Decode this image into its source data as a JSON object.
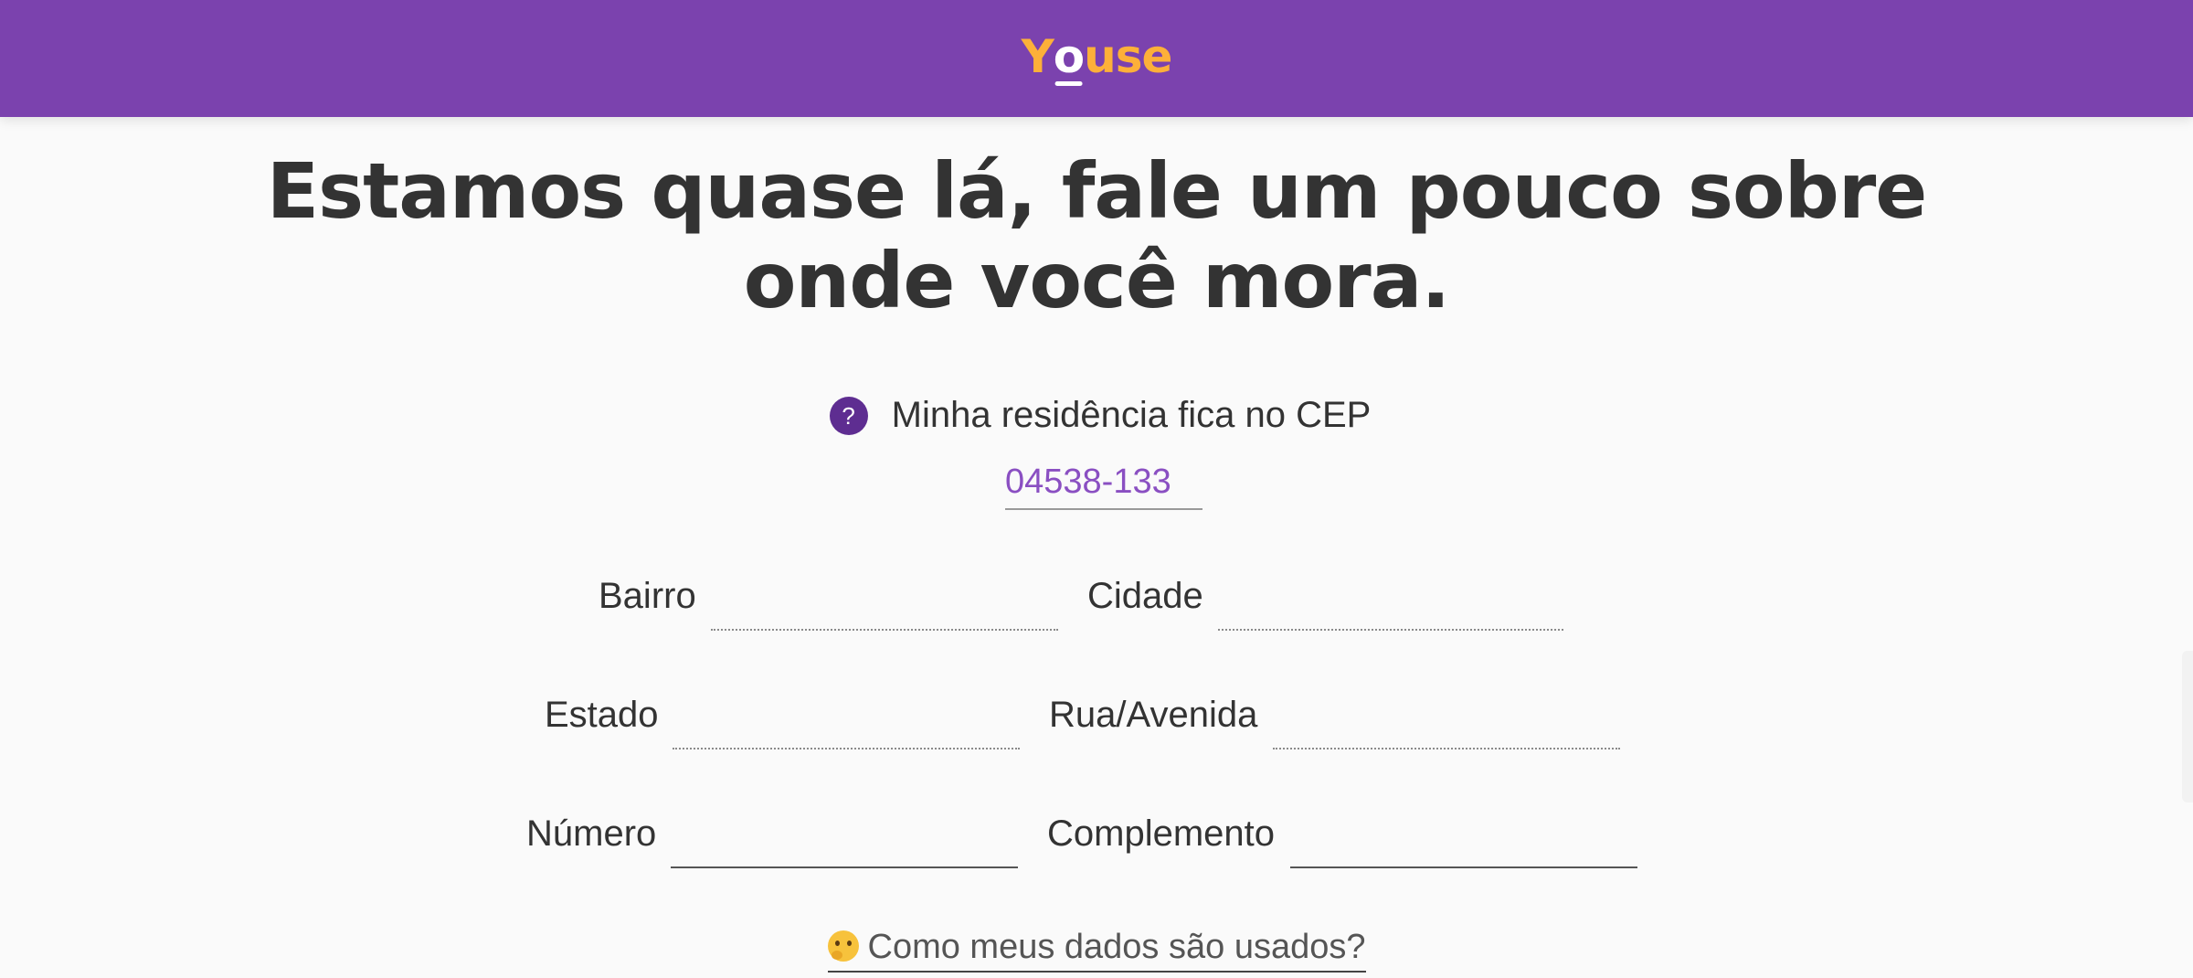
{
  "brand": {
    "logo_prefix": "Y",
    "logo_o": "o",
    "logo_suffix": "use",
    "primary_color": "#7b42ae",
    "accent_color": "#fdb039"
  },
  "headline": "Estamos quase lá, fale um pouco sobre onde você mora.",
  "cep": {
    "help_icon": "question-mark-icon",
    "help_glyph": "?",
    "label": "Minha residência fica no CEP",
    "value": "04538-133"
  },
  "fields": {
    "bairro_label": "Bairro",
    "bairro_value": "",
    "cidade_label": "Cidade",
    "cidade_value": "",
    "estado_label": "Estado",
    "estado_value": "",
    "rua_label": "Rua/Avenida",
    "rua_value": "",
    "numero_label": "Número",
    "numero_value": "",
    "complemento_label": "Complemento",
    "complemento_value": ""
  },
  "help_link": {
    "icon": "thinking-face-icon",
    "label": "Como meus dados são usados?"
  }
}
